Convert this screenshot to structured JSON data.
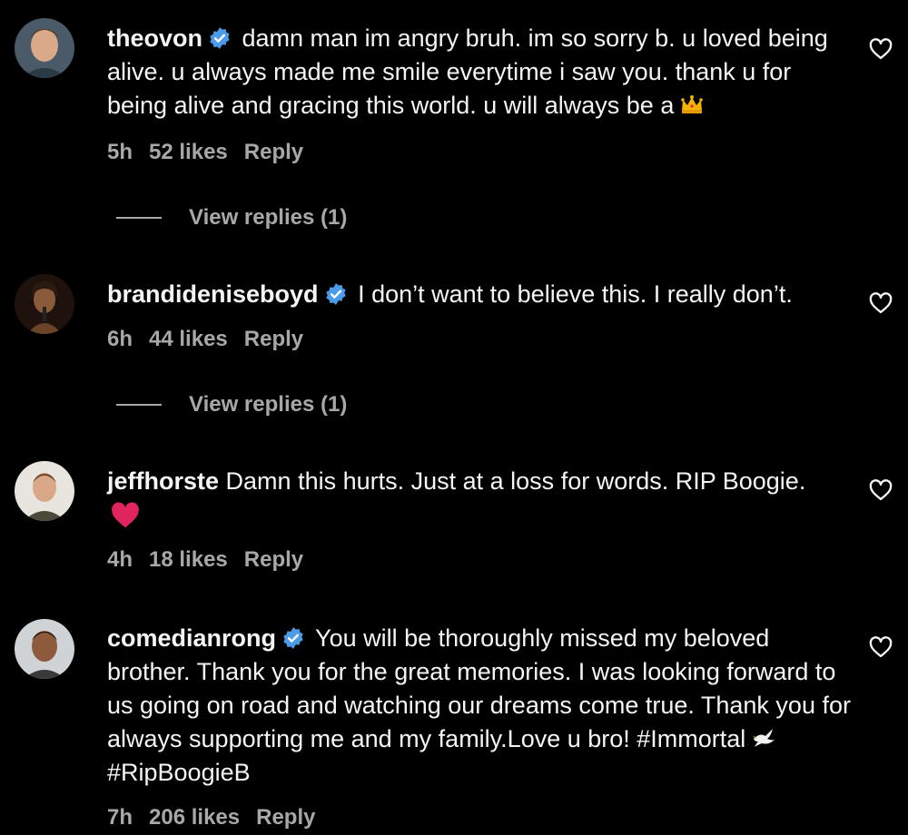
{
  "comments": [
    {
      "username": "theovon",
      "verified": true,
      "text": "damn man im angry bruh. im so sorry b. u loved being alive. u always made me smile everytime i saw you. thank u for being alive and gracing this world. u will always be a",
      "emoji": "crown-emoji",
      "time": "5h",
      "likes": "52 likes",
      "reply": "Reply",
      "view_replies": "View replies (1)"
    },
    {
      "username": "brandideniseboyd",
      "verified": true,
      "text": "I don’t want to believe this. I really don’t.",
      "time": "6h",
      "likes": "44 likes",
      "reply": "Reply",
      "view_replies": "View replies (1)"
    },
    {
      "username": "jeffhorste",
      "verified": false,
      "text": "Damn this hurts. Just at a loss for words. RIP Boogie.",
      "emoji": "red-heart-emoji",
      "time": "4h",
      "likes": "18 likes",
      "reply": "Reply"
    },
    {
      "username": "comedianrong",
      "verified": true,
      "text_before_emoji": "You will be thoroughly missed my beloved brother. Thank you for the great memories. I was looking forward to us going on road and watching our dreams come true. Thank you for always supporting me and my family.Love u bro! #Immortal",
      "emoji": "dove-emoji",
      "text_after_emoji": "#RipBoogieB",
      "time": "7h",
      "likes": "206 likes",
      "reply": "Reply"
    }
  ],
  "colors": {
    "background": "#000000",
    "text": "#f5f5f5",
    "secondary_text": "#a8a8a8",
    "verified_blue": "#0095f6",
    "heart_red": "#e0245e"
  }
}
